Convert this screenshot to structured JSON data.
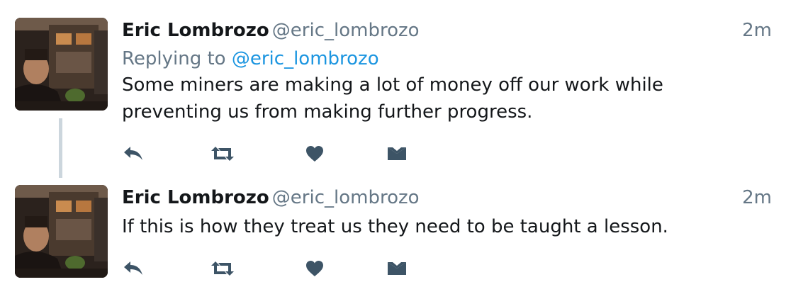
{
  "tweets": [
    {
      "author_name": "Eric Lombrozo",
      "author_handle": "@eric_lombrozo",
      "time": "2m",
      "reply_prefix": "Replying to",
      "reply_to": "@eric_lombrozo",
      "text_lines": [
        "Some miners are making a lot of money off our work while",
        "preventing us from making further progress."
      ]
    },
    {
      "author_name": "Eric Lombrozo",
      "author_handle": "@eric_lombrozo",
      "time": "2m",
      "text_lines": [
        "If this is how they treat us they need to be taught a lesson."
      ]
    }
  ],
  "icons": {
    "reply": "reply-icon",
    "retweet": "retweet-icon",
    "like": "heart-icon",
    "message": "envelope-icon"
  },
  "colors": {
    "text": "#14171a",
    "secondary": "#657786",
    "link": "#1b95e0",
    "action_icon": "#3d5466",
    "thread_line": "#ccd6dd"
  }
}
